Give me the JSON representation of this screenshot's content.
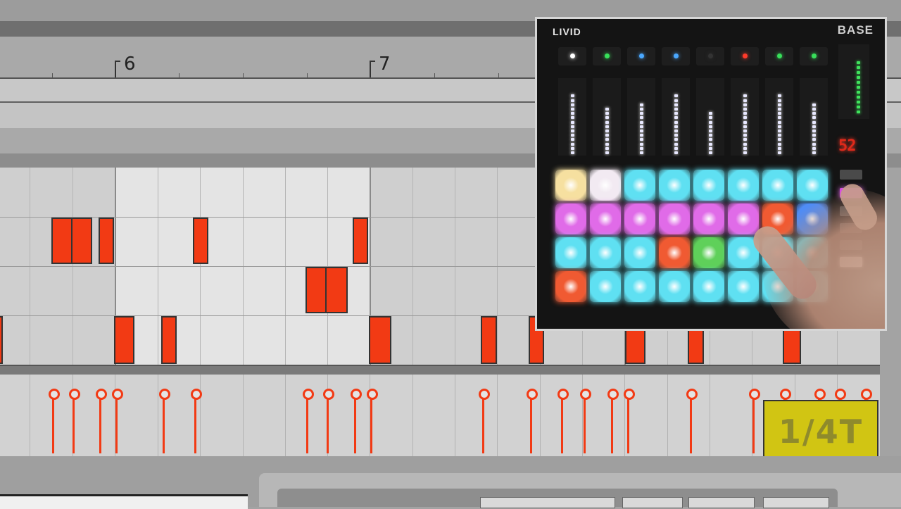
{
  "ruler": {
    "bar_numbers": [
      "6",
      "7"
    ]
  },
  "grid_badge": {
    "label": "1/4T"
  },
  "controller": {
    "brand": "LIVID",
    "model": "BASE",
    "display_value": "52",
    "top_leds": [
      "#ffffff",
      "#38e05a",
      "#4aa8ff",
      "#4aa8ff",
      "#333333",
      "#ff3a2a",
      "#38e05a",
      "#38e05a"
    ],
    "fader_levels": [
      0.85,
      0.7,
      0.75,
      0.85,
      0.65,
      0.9,
      0.9,
      0.75
    ],
    "pad_rows": [
      [
        "#f6e0a0",
        "#f2eaf2",
        "#5fe0f2",
        "#5fe0f2",
        "#5fe0f2",
        "#5fe0f2",
        "#5fe0f2",
        "#5fe0f2"
      ],
      [
        "#e06be8",
        "#e06be8",
        "#e06be8",
        "#e06be8",
        "#e06be8",
        "#e06be8",
        "#f05a32",
        "#4f8cf5"
      ],
      [
        "#5fe0f2",
        "#5fe0f2",
        "#5fe0f2",
        "#f05a32",
        "#5fd05a",
        "#5fe0f2",
        "#5fe0f2",
        "#5fe0f2"
      ],
      [
        "#f05a32",
        "#5fe0f2",
        "#5fe0f2",
        "#5fe0f2",
        "#5fe0f2",
        "#5fe0f2",
        "#5fe0f2",
        "#5fe0f2"
      ]
    ]
  },
  "colors": {
    "note": "#f23a14",
    "badge": "#d1c513",
    "loop_region": "#e4e4e4"
  }
}
